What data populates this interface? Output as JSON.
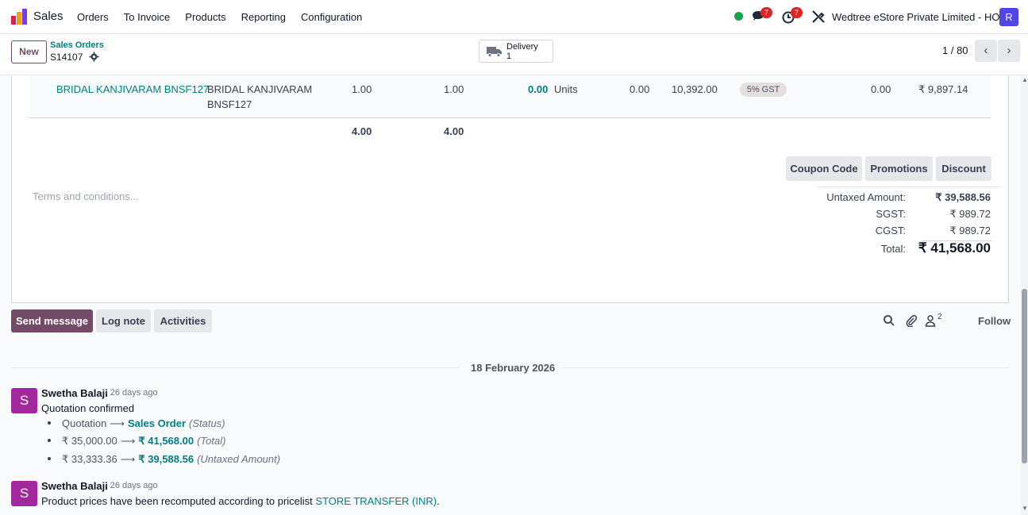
{
  "navbar": {
    "app_name": "Sales",
    "menu": [
      "Orders",
      "To Invoice",
      "Products",
      "Reporting",
      "Configuration"
    ],
    "messages_count": "7",
    "activities_count": "7",
    "company": "Wedtree eStore Private Limited - HO",
    "user_initial": "R",
    "status_color": "#16a34a"
  },
  "control": {
    "new_label": "New",
    "breadcrumb": "Sales Orders",
    "record": "S14107",
    "smart_button": {
      "label": "Delivery",
      "value": "1"
    },
    "pager": "1 / 80"
  },
  "order_line": {
    "product": "BRIDAL KANJIVARAM BNSF127",
    "description_1": "BRIDAL KANJIVARAM",
    "description_2": "BNSF127",
    "quantity": "1.00",
    "delivered": "1.00",
    "invoiced": "0.00",
    "uom": "Units",
    "lead_time": "0.00",
    "unit_price": "10,392.00",
    "tax": "5% GST",
    "discount": "0.00",
    "subtotal": "₹ 9,897.14"
  },
  "line_totals": {
    "quantity": "4.00",
    "delivered": "4.00"
  },
  "actions": {
    "coupon": "Coupon Code",
    "promotions": "Promotions",
    "discount": "Discount"
  },
  "terms_placeholder": "Terms and conditions...",
  "totals": {
    "untaxed_label": "Untaxed Amount:",
    "untaxed": "₹ 39,588.56",
    "sgst_label": "SGST:",
    "sgst": "₹ 989.72",
    "cgst_label": "CGST:",
    "cgst": "₹ 989.72",
    "total_label": "Total:",
    "total": "₹ 41,568.00"
  },
  "chatter": {
    "send_message": "Send message",
    "log_note": "Log note",
    "activities": "Activities",
    "followers_count": "2",
    "follow": "Follow",
    "date_separator": "18 February 2026",
    "messages": [
      {
        "avatar": "S",
        "author": "Swetha Balaji",
        "ago": "- 26 days ago",
        "body": "Quotation confirmed",
        "tracking": [
          {
            "old": "Quotation",
            "new": "Sales Order",
            "field": "(Status)"
          },
          {
            "old": "₹ 35,000.00",
            "new": "₹ 41,568.00",
            "field": "(Total)"
          },
          {
            "old": "₹ 33,333.36",
            "new": "₹ 39,588.56",
            "field": "(Untaxed Amount)"
          }
        ]
      },
      {
        "avatar": "S",
        "author": "Swetha Balaji",
        "ago": "- 26 days ago",
        "body": "Product prices have been recomputed according to pricelist ",
        "link": "STORE TRANSFER (INR)",
        "suffix": "."
      }
    ]
  },
  "colors": {
    "brand": "#714b67",
    "link": "#017e84",
    "badge": "#dc2626",
    "avatar": "#a3279d"
  }
}
